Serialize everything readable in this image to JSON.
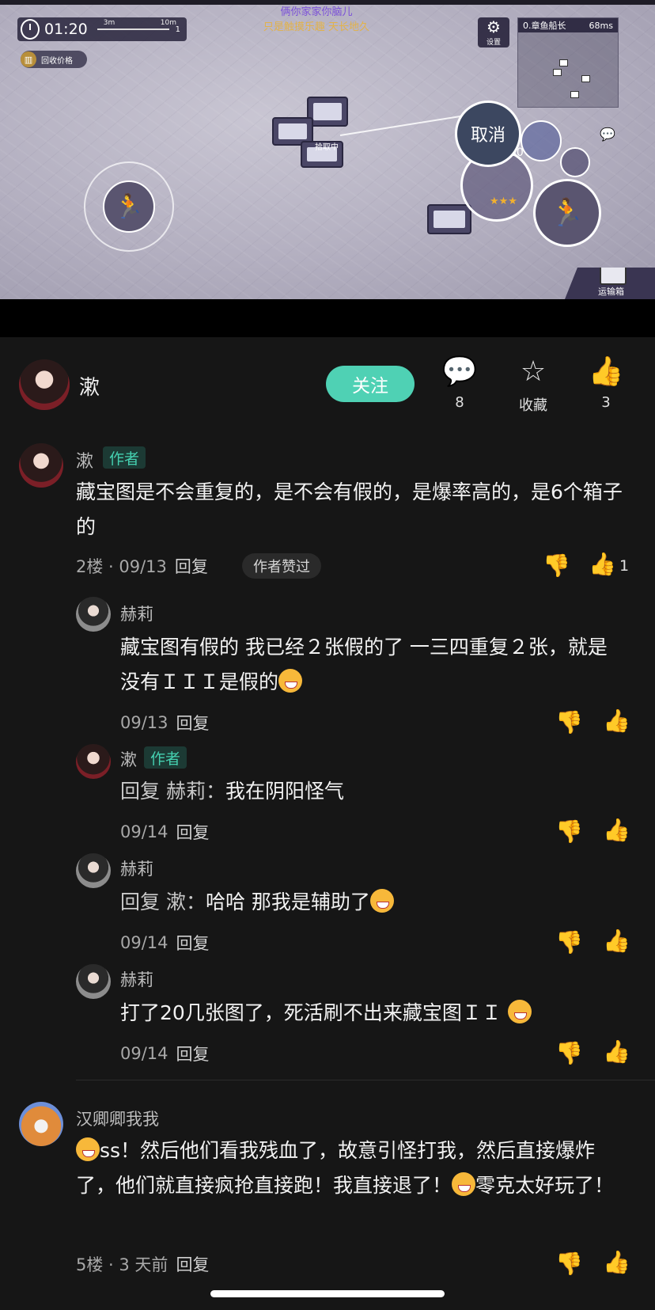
{
  "game": {
    "timer": "01:20",
    "track_ticks": [
      "3m",
      "10m"
    ],
    "player_count": "1",
    "recycle_label": "回收价格",
    "banner_line1": "俩你家家你脑儿",
    "banner_line2": "只是触摸乐趣 天长地久",
    "settings_label": "设置",
    "minimap_title": "0.章鱼船长",
    "ping": "68ms",
    "looting_label": "拾取中",
    "cancel_label": "取消",
    "durability": "180",
    "transport_label": "运输箱",
    "stars": "★★★"
  },
  "post": {
    "author_name": "漱",
    "follow_label": "关注",
    "comment_count": "8",
    "favorite_label": "收藏",
    "like_count": "3"
  },
  "comments": [
    {
      "name": "漱",
      "tag": "作者",
      "text": "藏宝图是不会重复的，是不会有假的，是爆率高的，是6个箱子的",
      "floor_time": "2楼 · 09/13",
      "reply": "回复",
      "praised": "作者赞过",
      "like_count": "1"
    },
    {
      "name": "赫莉",
      "text": "藏宝图有假的 我已经２张假的了 一三四重复２张，就是没有ＩＩＩ是假的",
      "time": "09/13",
      "reply": "回复"
    },
    {
      "name": "漱",
      "tag": "作者",
      "reply_prefix": "回复 赫莉：",
      "text": "我在阴阳怪气",
      "time": "09/14",
      "reply": "回复"
    },
    {
      "name": "赫莉",
      "reply_prefix": "回复 漱：",
      "text": "哈哈 那我是辅助了",
      "time": "09/14",
      "reply": "回复"
    },
    {
      "name": "赫莉",
      "text": "打了20几张图了，死活刷不出来藏宝图ＩＩ",
      "time": "09/14",
      "reply": "回复"
    },
    {
      "name": "汉卿卿我我",
      "text_part1": "ss！然后他们看我残血了，故意引怪打我，然后直接爆炸了，他们就直接疯抢直接跑！我直接退了！",
      "text_part2": "零克太好玩了！",
      "floor_time": "5楼 · 3 天前",
      "reply": "回复"
    }
  ]
}
